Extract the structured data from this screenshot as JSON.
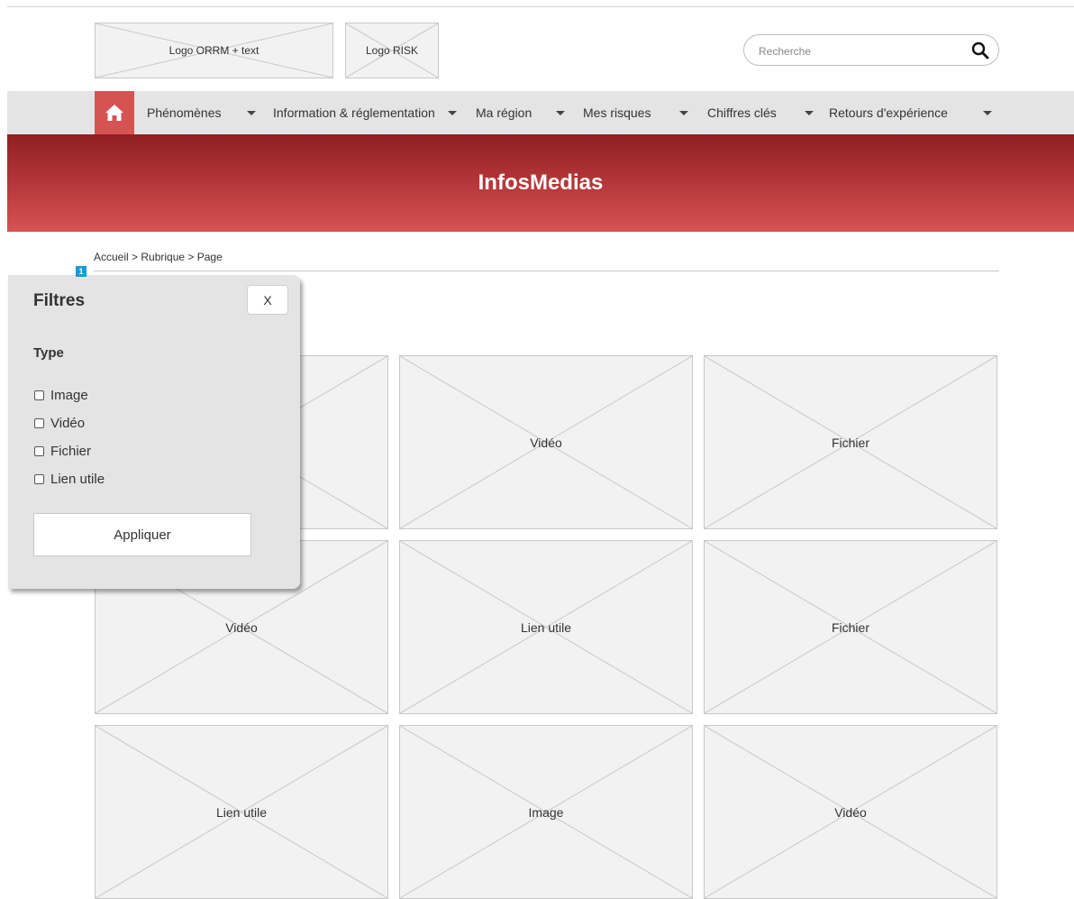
{
  "header": {
    "logo_orrm": "Logo ORRM + text",
    "logo_risk": "Logo RISK",
    "search_placeholder": "Recherche"
  },
  "nav": {
    "items": [
      {
        "label": "Phénomènes"
      },
      {
        "label": "Information & réglementation"
      },
      {
        "label": "Ma région"
      },
      {
        "label": "Mes risques"
      },
      {
        "label": "Chiffres clés"
      },
      {
        "label": "Retours d'expérience"
      }
    ]
  },
  "banner": {
    "title": "InfosMedias"
  },
  "breadcrumb": "Accueil > Rubrique > Page",
  "filters": {
    "badge": "1",
    "title": "Filtres",
    "close_label": "X",
    "section_title": "Type",
    "options": [
      {
        "label": "Image",
        "checked": false
      },
      {
        "label": "Vidéo",
        "checked": false
      },
      {
        "label": "Fichier",
        "checked": false
      },
      {
        "label": "Lien utile",
        "checked": false
      }
    ],
    "apply_label": "Appliquer"
  },
  "grid": {
    "cards": [
      {
        "label": ""
      },
      {
        "label": "Vidéo"
      },
      {
        "label": "Fichier"
      },
      {
        "label": "Vidéo"
      },
      {
        "label": "Lien utile"
      },
      {
        "label": "Fichier"
      },
      {
        "label": "Lien utile"
      },
      {
        "label": "Image"
      },
      {
        "label": "Vidéo"
      }
    ]
  }
}
